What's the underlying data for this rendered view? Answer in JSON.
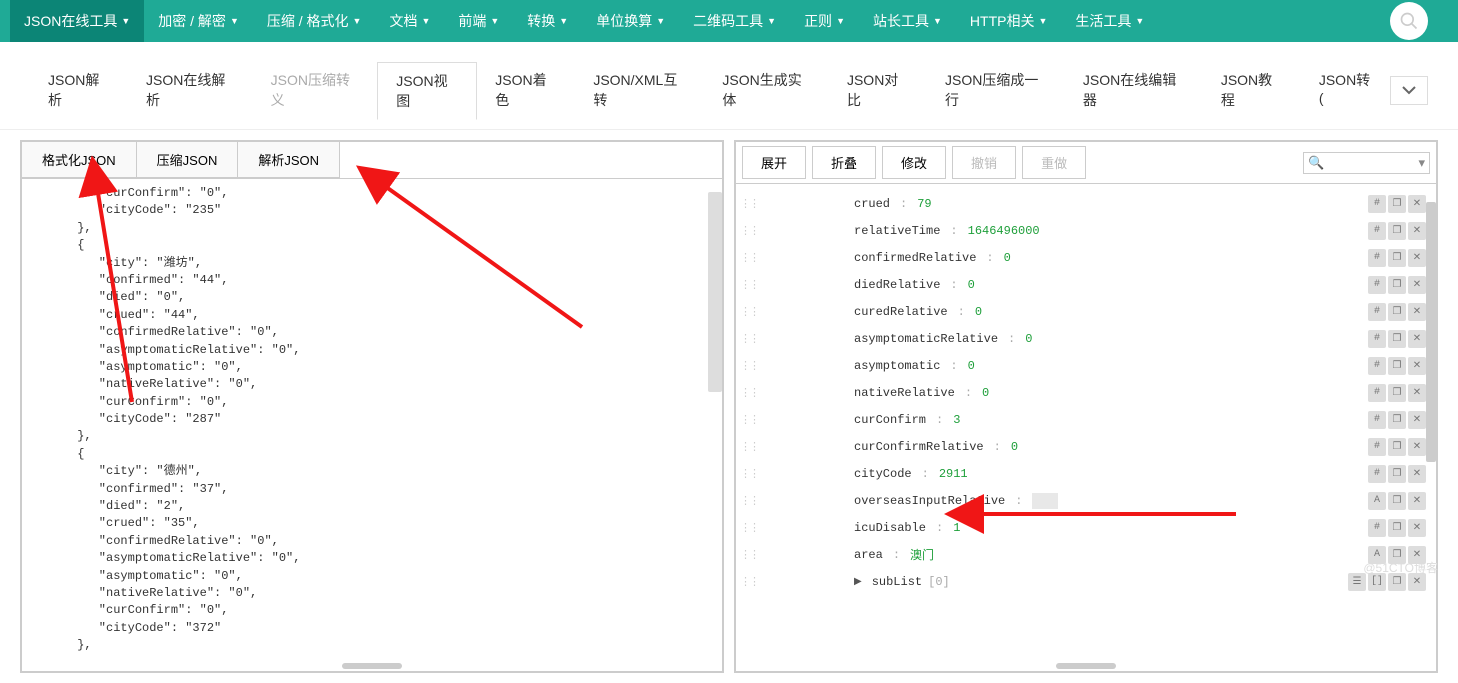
{
  "nav": {
    "items": [
      {
        "label": "JSON在线工具",
        "active": true,
        "caret": true
      },
      {
        "label": "加密 / 解密",
        "caret": true
      },
      {
        "label": "压缩 / 格式化",
        "caret": true
      },
      {
        "label": "文档",
        "caret": true
      },
      {
        "label": "前端",
        "caret": true
      },
      {
        "label": "转换",
        "caret": true
      },
      {
        "label": "单位换算",
        "caret": true
      },
      {
        "label": "二维码工具",
        "caret": true
      },
      {
        "label": "正则",
        "caret": true
      },
      {
        "label": "站长工具",
        "caret": true
      },
      {
        "label": "HTTP相关",
        "caret": true
      },
      {
        "label": "生活工具",
        "caret": true
      }
    ]
  },
  "sub_tabs": [
    {
      "label": "JSON解析"
    },
    {
      "label": "JSON在线解析"
    },
    {
      "label": "JSON压缩转义",
      "disabled": true
    },
    {
      "label": "JSON视图",
      "active": true
    },
    {
      "label": "JSON着色"
    },
    {
      "label": "JSON/XML互转"
    },
    {
      "label": "JSON生成实体"
    },
    {
      "label": "JSON对比"
    },
    {
      "label": "JSON压缩成一行"
    },
    {
      "label": "JSON在线编辑器"
    },
    {
      "label": "JSON教程"
    },
    {
      "label": "JSON转("
    }
  ],
  "left_buttons": {
    "format": "格式化JSON",
    "compress": "压缩JSON",
    "parse": "解析JSON"
  },
  "left_code": "         \"curConfirm\": \"0\",\n         \"cityCode\": \"235\"\n      },\n      {\n         \"city\": \"潍坊\",\n         \"confirmed\": \"44\",\n         \"died\": \"0\",\n         \"crued\": \"44\",\n         \"confirmedRelative\": \"0\",\n         \"asymptomaticRelative\": \"0\",\n         \"asymptomatic\": \"0\",\n         \"nativeRelative\": \"0\",\n         \"curConfirm\": \"0\",\n         \"cityCode\": \"287\"\n      },\n      {\n         \"city\": \"德州\",\n         \"confirmed\": \"37\",\n         \"died\": \"2\",\n         \"crued\": \"35\",\n         \"confirmedRelative\": \"0\",\n         \"asymptomaticRelative\": \"0\",\n         \"asymptomatic\": \"0\",\n         \"nativeRelative\": \"0\",\n         \"curConfirm\": \"0\",\n         \"cityCode\": \"372\"\n      },",
  "right_toolbar": {
    "expand": "展开",
    "collapse": "折叠",
    "modify": "修改",
    "undo": "撤销",
    "redo": "重做"
  },
  "tree_rows": [
    {
      "key": "crued",
      "val": "79",
      "type": "num"
    },
    {
      "key": "relativeTime",
      "val": "1646496000",
      "type": "num"
    },
    {
      "key": "confirmedRelative",
      "val": "0",
      "type": "num"
    },
    {
      "key": "diedRelative",
      "val": "0",
      "type": "num"
    },
    {
      "key": "curedRelative",
      "val": "0",
      "type": "num"
    },
    {
      "key": "asymptomaticRelative",
      "val": "0",
      "type": "num"
    },
    {
      "key": "asymptomatic",
      "val": "0",
      "type": "num"
    },
    {
      "key": "nativeRelative",
      "val": "0",
      "type": "num"
    },
    {
      "key": "curConfirm",
      "val": "3",
      "type": "num"
    },
    {
      "key": "curConfirmRelative",
      "val": "0",
      "type": "num"
    },
    {
      "key": "cityCode",
      "val": "2911",
      "type": "num"
    },
    {
      "key": "overseasInputRelative",
      "val": "",
      "type": "empty"
    },
    {
      "key": "icuDisable",
      "val": "1",
      "type": "num"
    },
    {
      "key": "area",
      "val": "澳门",
      "type": "str"
    },
    {
      "key": "subList",
      "val": "[0]",
      "type": "arr",
      "expandable": true
    }
  ],
  "watermark": "@51CTO博客"
}
